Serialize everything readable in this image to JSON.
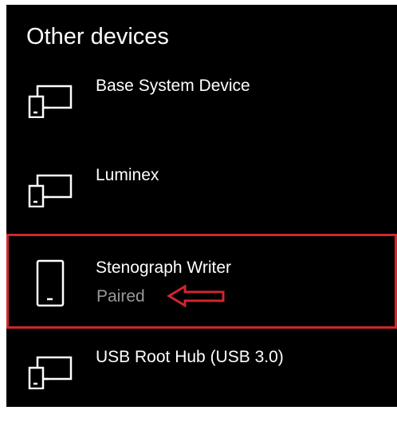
{
  "section": {
    "title": "Other devices"
  },
  "devices": [
    {
      "name": "Base System Device",
      "status": "",
      "icon": "desktop-phone-icon"
    },
    {
      "name": "Luminex",
      "status": "",
      "icon": "desktop-phone-icon"
    },
    {
      "name": "Stenograph Writer",
      "status": "Paired",
      "icon": "phone-icon"
    },
    {
      "name": "USB Root Hub (USB 3.0)",
      "status": "",
      "icon": "desktop-phone-icon"
    }
  ],
  "colors": {
    "background": "#000000",
    "text": "#ffffff",
    "status_text": "#9a9a9a",
    "annotation": "#d0262e"
  }
}
